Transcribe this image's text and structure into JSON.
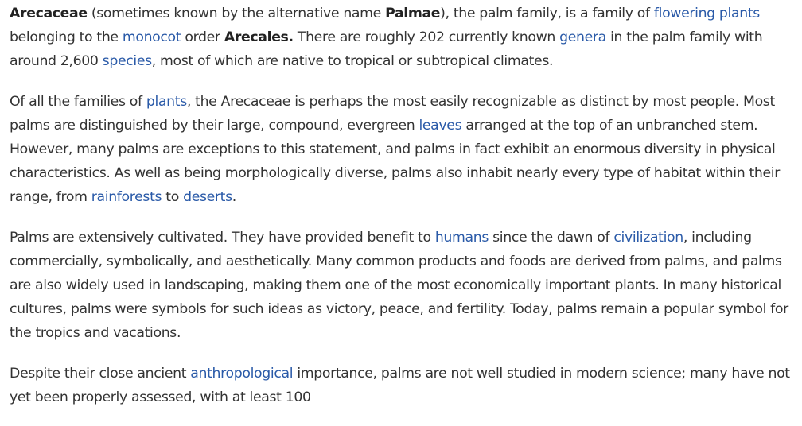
{
  "article": {
    "p1": {
      "s1": "Arecaceae",
      "t1": " (sometimes known by the alternative name ",
      "s2": "Palmae",
      "t2": "), the palm family, is a family of ",
      "l1": "flowering plants",
      "t3": " belonging to the ",
      "l2": "monocot",
      "t4": " order ",
      "s3": "Arecales.",
      "t5": " There are roughly 202 currently known ",
      "l3": "genera",
      "t6": " in the palm family with around 2,600 ",
      "l4": "species",
      "t7": ", most of which are native to tropical or subtropical climates."
    },
    "p2": {
      "t1": "Of all the families of ",
      "l1": "plants",
      "t2": ", the Arecaceae is perhaps the most easily recognizable as distinct by most people. Most palms are distinguished by their large, compound, evergreen ",
      "l2": "leaves",
      "t3": " arranged at the top of an unbranched stem. However, many palms are exceptions to this statement, and palms in fact exhibit an enormous diversity in physical characteristics. As well as being morphologically diverse, palms also inhabit nearly every type of habitat within their range, from ",
      "l3": "rainforests",
      "t4": " to ",
      "l4": "deserts",
      "t5": "."
    },
    "p3": {
      "t1": "Palms are extensively cultivated. They have provided benefit to ",
      "l1": "humans",
      "t2": " since the dawn of ",
      "l2": "civilization",
      "t3": ", including commercially, symbolically, and aesthetically. Many common products and foods are derived from palms, and palms are also widely used in landscaping, making them one of the most economically important plants. In many historical cultures, palms were symbols for such ideas as victory, peace, and fertility. Today, palms remain a popular symbol for the tropics and vacations."
    },
    "p4": {
      "t1": "Despite their close ancient ",
      "l1": "anthropological",
      "t2": " importance, palms are not well ",
      "t3": "studied in modern science; many have not yet been properly assessed, with at least 100"
    }
  },
  "colors": {
    "text": "#333333",
    "link": "#2a5aa8",
    "background": "#ffffff"
  }
}
